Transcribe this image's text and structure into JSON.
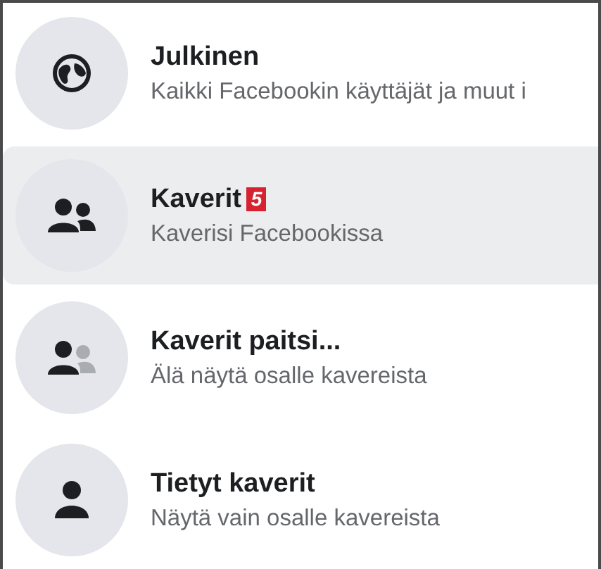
{
  "options": [
    {
      "kind": "globe",
      "title": "Julkinen",
      "subtitle": "Kaikki Facebookin käyttäjät ja muut i",
      "selected": false
    },
    {
      "kind": "friends",
      "title": "Kaverit",
      "badge": "5",
      "subtitle": "Kaverisi Facebookissa",
      "selected": true
    },
    {
      "kind": "friends-except",
      "title": "Kaverit paitsi...",
      "subtitle": "Älä näytä osalle kavereista",
      "selected": false
    },
    {
      "kind": "person",
      "title": "Tietyt kaverit",
      "subtitle": "Näytä vain osalle kavereista",
      "selected": false
    }
  ]
}
